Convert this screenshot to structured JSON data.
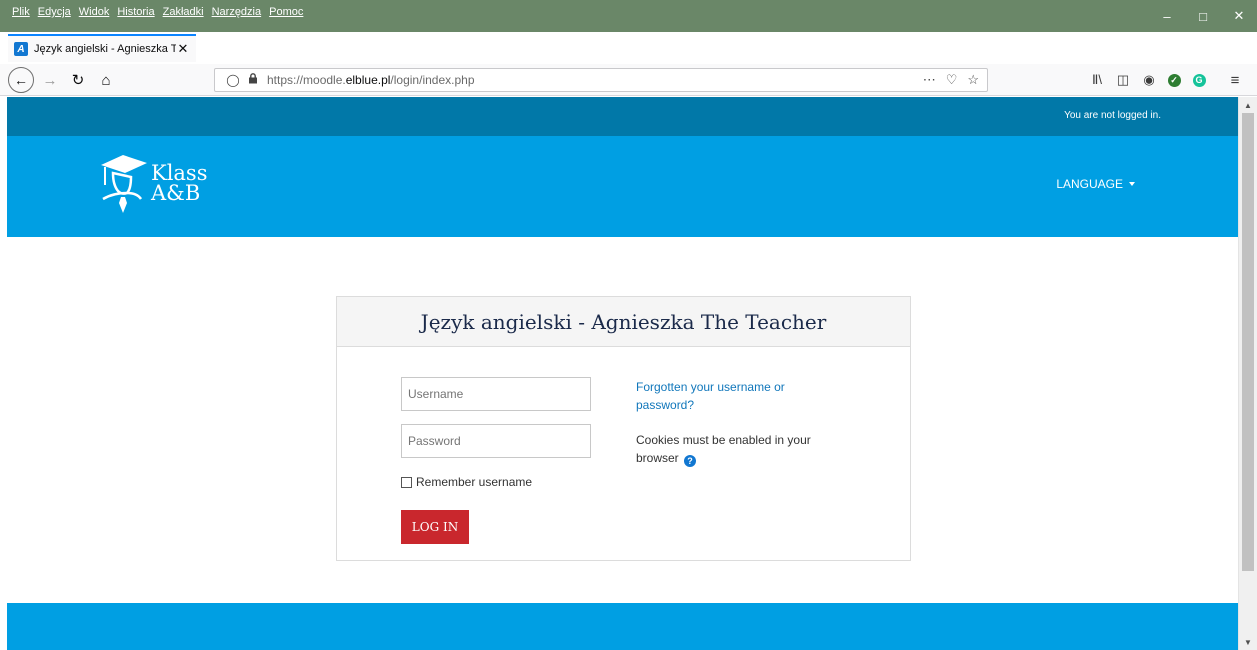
{
  "browser": {
    "menu": [
      "Plik",
      "Edycja",
      "Widok",
      "Historia",
      "Zakładki",
      "Narzędzia",
      "Pomoc"
    ],
    "tab": {
      "title": "Język angielski - Agnieszka The",
      "favicon": "A"
    },
    "url": {
      "prefix": "https://moodle.",
      "domain": "elblue.pl",
      "path": "/login/index.php"
    },
    "accent_color": "#0a84ff",
    "titlebar_color": "#6a8768"
  },
  "page": {
    "login_status": "You are not logged in.",
    "brand": {
      "line1": "Klass",
      "line2": "A&B"
    },
    "language_label": "LANGUAGE",
    "card": {
      "title": "Język angielski - Agnieszka The Teacher",
      "username_placeholder": "Username",
      "password_placeholder": "Password",
      "remember_label": "Remember username",
      "login_button": "LOG IN",
      "forgot_link": "Forgotten your username or password?",
      "cookies_text": "Cookies must be enabled in your browser",
      "help_glyph": "?"
    },
    "colors": {
      "topbar": "#0178a8",
      "header": "#009fe3",
      "button": "#c9272d",
      "link": "#1177bb"
    }
  }
}
